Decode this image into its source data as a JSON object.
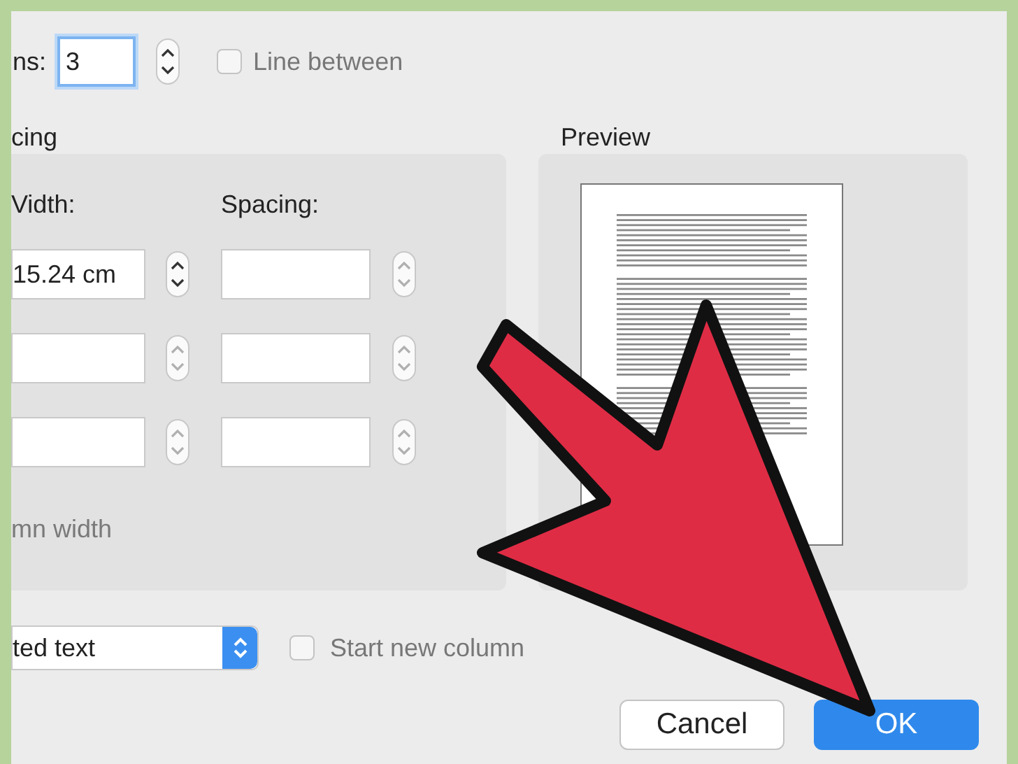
{
  "columns": {
    "label": "ns:",
    "value": "3"
  },
  "line_between": {
    "label": "Line between",
    "checked": false
  },
  "spacing_section": {
    "title": "cing",
    "headers": [
      "Vidth:",
      "Spacing:"
    ],
    "rows": [
      {
        "width": "15.24 cm",
        "enabled": true
      },
      {
        "enabled": false
      },
      {
        "enabled": false
      }
    ],
    "equal_width": {
      "label": "mn width",
      "disabled": true
    }
  },
  "preview": {
    "title": "Preview"
  },
  "apply": {
    "value": "ted text"
  },
  "start_new_column": {
    "label": "Start new column",
    "checked": false
  },
  "buttons": [
    {
      "label": "Cancel",
      "kind": "secondary"
    },
    {
      "label": "OK",
      "kind": "default"
    }
  ]
}
